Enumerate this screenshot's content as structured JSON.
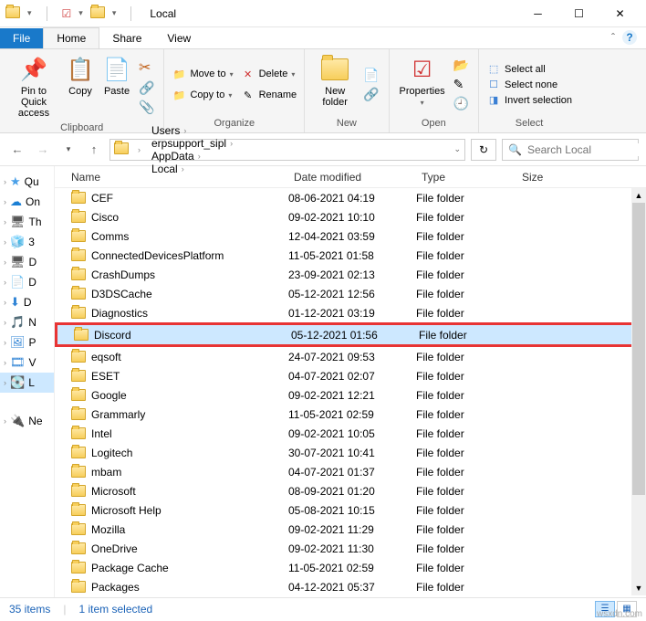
{
  "window": {
    "title": "Local"
  },
  "tabs": {
    "file": "File",
    "home": "Home",
    "share": "Share",
    "view": "View"
  },
  "ribbon": {
    "clipboard": {
      "label": "Clipboard",
      "pin": "Pin to Quick access",
      "copy": "Copy",
      "paste": "Paste"
    },
    "organize": {
      "label": "Organize",
      "moveto": "Move to",
      "copyto": "Copy to",
      "delete": "Delete",
      "rename": "Rename"
    },
    "new": {
      "label": "New",
      "newfolder": "New folder"
    },
    "open": {
      "label": "Open",
      "properties": "Properties"
    },
    "select": {
      "label": "Select",
      "selectall": "Select all",
      "selectnone": "Select none",
      "invert": "Invert selection"
    }
  },
  "breadcrumb": [
    "Users",
    "erpsupport_sipl",
    "AppData",
    "Local"
  ],
  "search": {
    "placeholder": "Search Local"
  },
  "columns": {
    "name": "Name",
    "date": "Date modified",
    "type": "Type",
    "size": "Size"
  },
  "nav": [
    {
      "icon": "★",
      "color": "#4aa0e8",
      "label": "Qu"
    },
    {
      "icon": "☁",
      "color": "#1a7fd4",
      "label": "On"
    },
    {
      "icon": "🖥",
      "color": "#555",
      "label": "Th"
    },
    {
      "icon": "🧊",
      "color": "#3a9dd6",
      "label": "3"
    },
    {
      "icon": "🖥",
      "color": "#555",
      "label": "D"
    },
    {
      "icon": "📄",
      "color": "#555",
      "label": "D"
    },
    {
      "icon": "⬇",
      "color": "#3285d6",
      "label": "D"
    },
    {
      "icon": "🎵",
      "color": "#3285d6",
      "label": "N"
    },
    {
      "icon": "🖼",
      "color": "#3285d6",
      "label": "P"
    },
    {
      "icon": "🎞",
      "color": "#3285d6",
      "label": "V"
    },
    {
      "icon": "💽",
      "color": "#888",
      "label": "L",
      "selected": true
    },
    {
      "icon": "",
      "color": "",
      "label": ""
    },
    {
      "icon": "🔌",
      "color": "#3285d6",
      "label": "Ne"
    }
  ],
  "rows": [
    {
      "name": "CEF",
      "date": "08-06-2021 04:19",
      "type": "File folder"
    },
    {
      "name": "Cisco",
      "date": "09-02-2021 10:10",
      "type": "File folder"
    },
    {
      "name": "Comms",
      "date": "12-04-2021 03:59",
      "type": "File folder"
    },
    {
      "name": "ConnectedDevicesPlatform",
      "date": "11-05-2021 01:58",
      "type": "File folder"
    },
    {
      "name": "CrashDumps",
      "date": "23-09-2021 02:13",
      "type": "File folder"
    },
    {
      "name": "D3DSCache",
      "date": "05-12-2021 12:56",
      "type": "File folder"
    },
    {
      "name": "Diagnostics",
      "date": "01-12-2021 03:19",
      "type": "File folder"
    },
    {
      "name": "Discord",
      "date": "05-12-2021 01:56",
      "type": "File folder",
      "selected": true,
      "highlighted": true
    },
    {
      "name": "eqsoft",
      "date": "24-07-2021 09:53",
      "type": "File folder"
    },
    {
      "name": "ESET",
      "date": "04-07-2021 02:07",
      "type": "File folder"
    },
    {
      "name": "Google",
      "date": "09-02-2021 12:21",
      "type": "File folder"
    },
    {
      "name": "Grammarly",
      "date": "11-05-2021 02:59",
      "type": "File folder"
    },
    {
      "name": "Intel",
      "date": "09-02-2021 10:05",
      "type": "File folder"
    },
    {
      "name": "Logitech",
      "date": "30-07-2021 10:41",
      "type": "File folder"
    },
    {
      "name": "mbam",
      "date": "04-07-2021 01:37",
      "type": "File folder"
    },
    {
      "name": "Microsoft",
      "date": "08-09-2021 01:20",
      "type": "File folder"
    },
    {
      "name": "Microsoft Help",
      "date": "05-08-2021 10:15",
      "type": "File folder"
    },
    {
      "name": "Mozilla",
      "date": "09-02-2021 11:29",
      "type": "File folder"
    },
    {
      "name": "OneDrive",
      "date": "09-02-2021 11:30",
      "type": "File folder"
    },
    {
      "name": "Package Cache",
      "date": "11-05-2021 02:59",
      "type": "File folder"
    },
    {
      "name": "Packages",
      "date": "04-12-2021 05:37",
      "type": "File folder"
    }
  ],
  "status": {
    "items": "35 items",
    "selected": "1 item selected"
  },
  "watermark": "wsxdn.com"
}
